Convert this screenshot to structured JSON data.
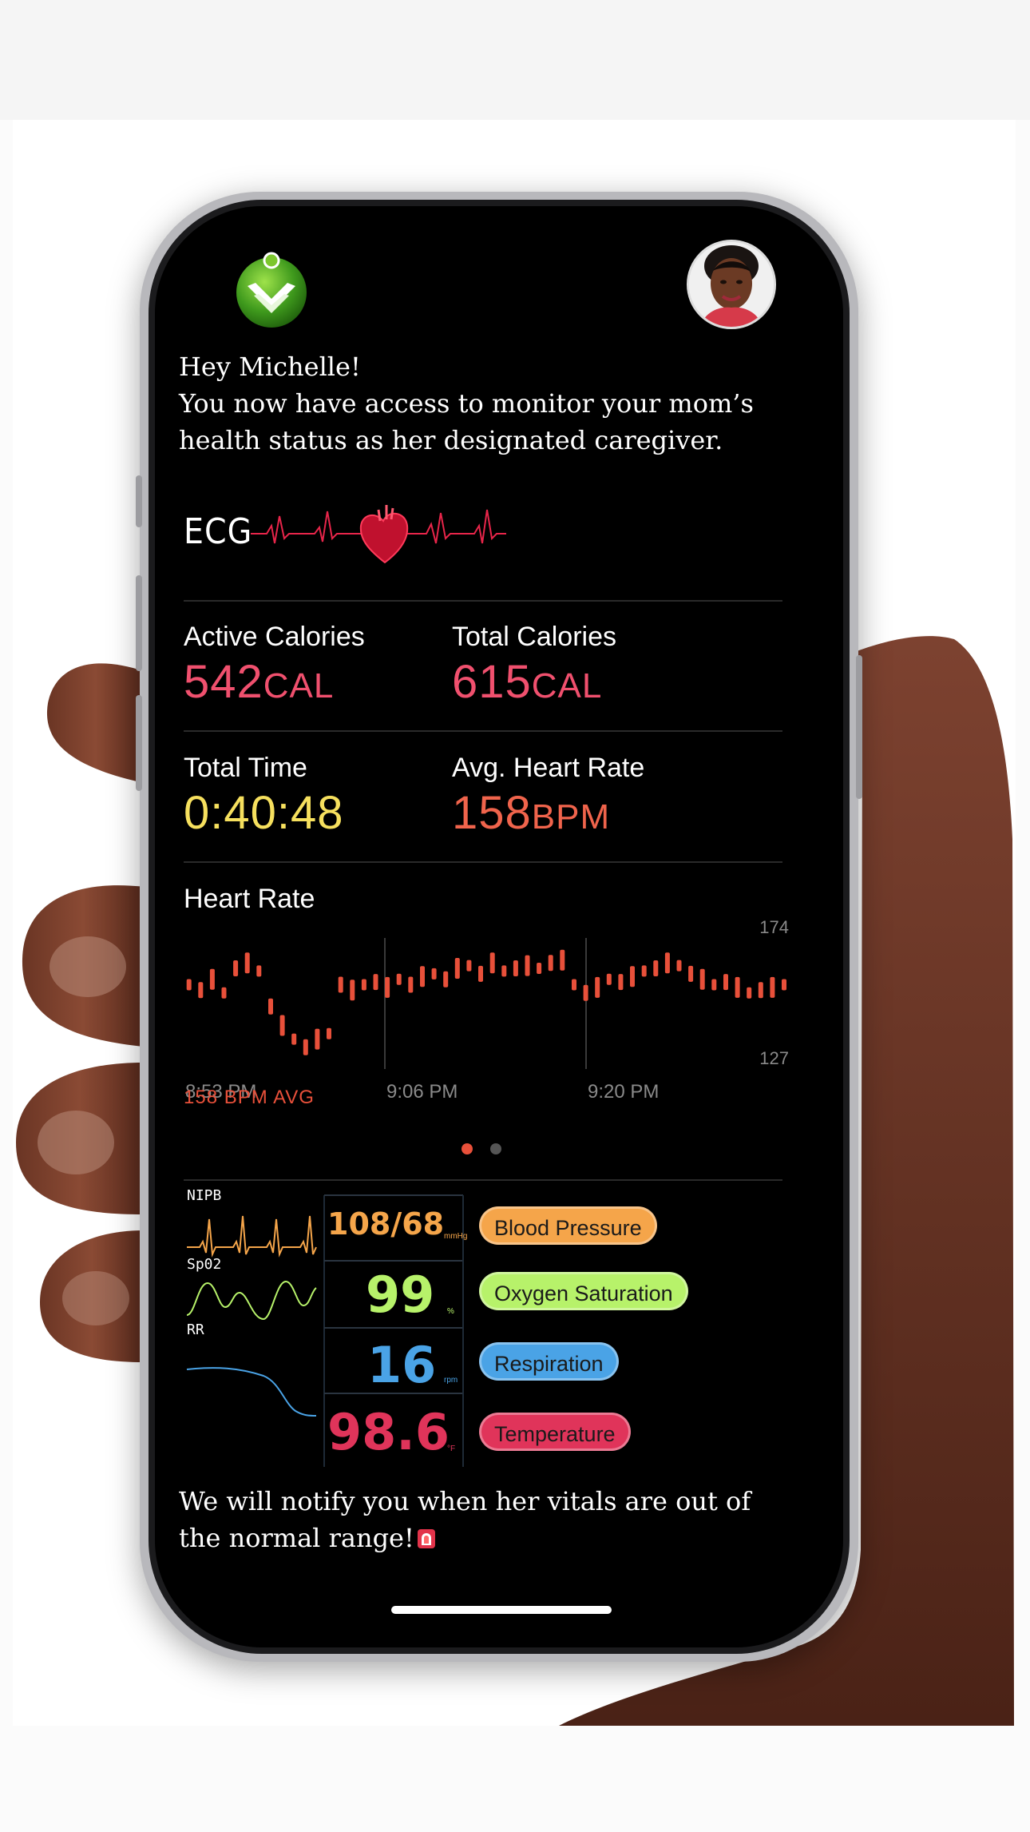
{
  "greeting": {
    "line1": "Hey Michelle!",
    "line2": "You now have access to  monitor your mom’s",
    "line3": " health status as her  designated caregiver."
  },
  "ecg": {
    "label": "ECG"
  },
  "stats": {
    "active_calories": {
      "label": "Active Calories",
      "value": "542",
      "unit": "CAL",
      "color": "#f0506e"
    },
    "total_calories": {
      "label": "Total Calories",
      "value": "615",
      "unit": "CAL",
      "color": "#f0506e"
    },
    "total_time": {
      "label": "Total Time",
      "value": "0:40:48",
      "color": "#f6e05e"
    },
    "avg_heart_rate": {
      "label": "Avg. Heart Rate",
      "value": "158",
      "unit": "BPM",
      "color": "#f0644c"
    }
  },
  "heart_rate": {
    "title": "Heart Rate",
    "avg_label": "158 BPM AVG",
    "color": "#e8503a"
  },
  "chart_data": {
    "type": "bar",
    "title": "Heart Rate",
    "x_tick_labels": [
      "8:53 PM",
      "9:06 PM",
      "9:20 PM"
    ],
    "y_tick_labels": [
      "174",
      "127"
    ],
    "ylim": [
      127,
      174
    ],
    "grid": true,
    "series": [
      {
        "values": [
          158,
          156,
          160,
          155,
          164,
          166,
          163,
          150,
          143,
          138,
          135,
          138,
          140,
          158,
          156,
          158,
          159,
          157,
          160,
          158,
          161,
          162,
          160,
          164,
          165,
          162,
          166,
          163,
          164,
          165,
          164,
          166,
          167,
          158,
          155,
          157,
          160,
          159,
          161,
          163,
          164,
          166,
          165,
          162,
          160,
          158,
          159,
          157,
          155,
          156,
          157,
          158
        ]
      }
    ]
  },
  "pager": {
    "active_color": "#e8503a",
    "inactive_color": "#555555"
  },
  "vitals": {
    "nipb_label": "NIPB",
    "spo2_label": "Sp02",
    "rr_label": "RR",
    "bp_value": "108/68",
    "bp_unit": "mmHg",
    "spo2_value": "99",
    "spo2_unit": "%",
    "rr_value": "16",
    "rr_unit": "rpm",
    "temp_value": "98.6",
    "temp_unit": "°F",
    "bp_pill": "Blood Pressure",
    "spo2_pill": "Oxygen Saturation",
    "rr_pill": "Respiration",
    "temp_pill": "Temperature",
    "colors": {
      "bp": "#f5a54a",
      "spo2": "#b7f26a",
      "rr": "#4aa3e6",
      "temp": "#e0345a"
    }
  },
  "footer": {
    "line1": "We will notify you when her  vitals are out of",
    "line2": " the normal range!"
  }
}
